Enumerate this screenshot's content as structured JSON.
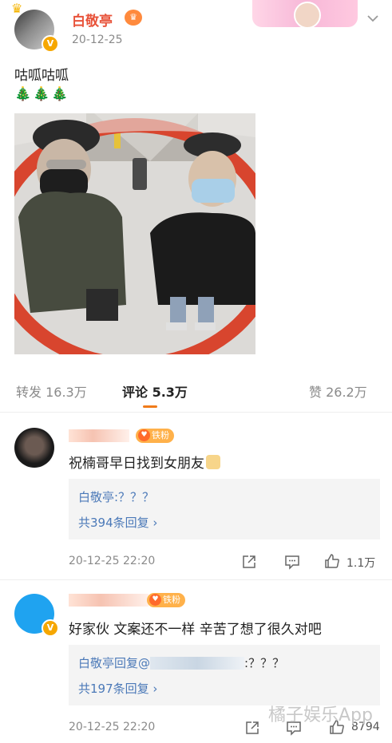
{
  "post": {
    "author": "白敬亭",
    "time": "20-12-25",
    "text": "咕呱咕呱",
    "emoji": "🎄🎄🎄"
  },
  "tabs": [
    {
      "label": "转发 16.3万"
    },
    {
      "label": "评论 5.3万"
    },
    {
      "label": "赞 26.2万"
    }
  ],
  "comments": [
    {
      "badge": "铁粉",
      "text": "祝楠哥早日找到女朋友",
      "reply_line": "白敬亭:？？？",
      "reply_count": "共394条回复 ›",
      "time": "20-12-25 22:20",
      "likes": "1.1万"
    },
    {
      "badge": "铁粉",
      "text": "好家伙 文案还不一样 辛苦了想了很久对吧",
      "reply_author": "白敬亭回复@",
      "reply_tail": ":？？？",
      "reply_count": "共197条回复 ›",
      "time": "20-12-25 22:20",
      "likes": "8794"
    }
  ],
  "watermark": "橘子娱乐App",
  "colors": {
    "accent": "#f07b1a",
    "link": "#4b79b8",
    "author": "#e8533a",
    "badge": "#ffb14a"
  }
}
